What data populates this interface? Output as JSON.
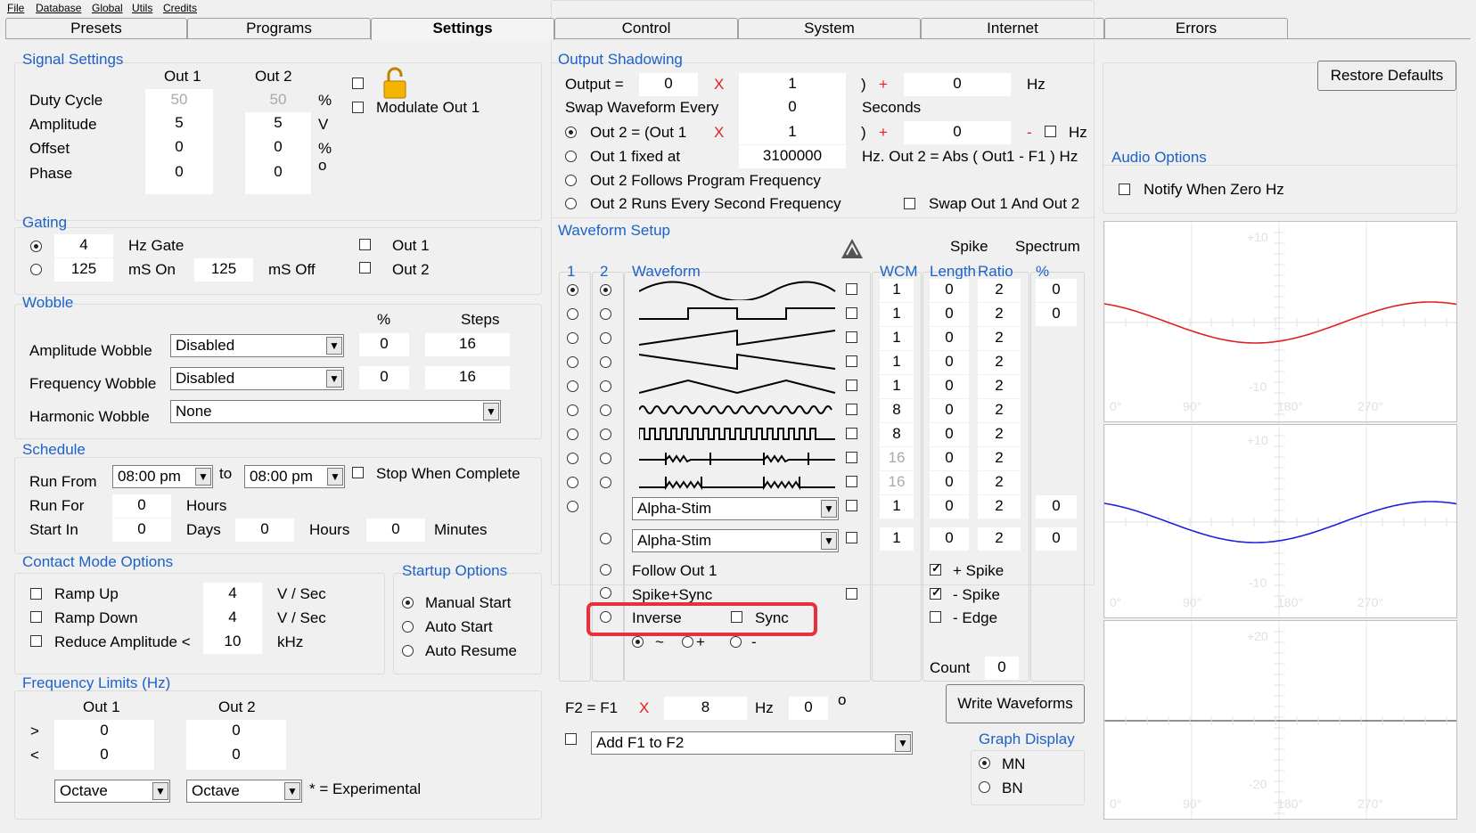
{
  "menu": [
    "File",
    "Database",
    "Global",
    "Utils",
    "Credits"
  ],
  "tabs": [
    "Presets",
    "Programs",
    "Settings",
    "Control",
    "System",
    "Internet",
    "Errors"
  ],
  "signal": {
    "title": "Signal Settings",
    "col1": "Out 1",
    "col2": "Out 2",
    "rows": [
      {
        "label": "Duty Cycle",
        "v1": "50",
        "v2": "50",
        "unit": "%"
      },
      {
        "label": "Amplitude",
        "v1": "5",
        "v2": "5",
        "unit": "V"
      },
      {
        "label": "Offset",
        "v1": "0",
        "v2": "0",
        "unit": "%"
      },
      {
        "label": "Phase",
        "v1": "0",
        "v2": "0",
        "unit": "o"
      }
    ],
    "modulate": "Modulate Out 1"
  },
  "gating": {
    "title": "Gating",
    "hz": "4",
    "hz_label": "Hz Gate",
    "ms_on": "125",
    "ms_on_label": "mS On",
    "ms_off": "125",
    "ms_off_label": "mS Off",
    "out1": "Out 1",
    "out2": "Out 2"
  },
  "wobble": {
    "title": "Wobble",
    "pct": "%",
    "steps": "Steps",
    "rows": [
      {
        "label": "Amplitude Wobble",
        "value": "Disabled",
        "pct": "0",
        "steps": "16"
      },
      {
        "label": "Frequency Wobble",
        "value": "Disabled",
        "pct": "0",
        "steps": "16"
      },
      {
        "label": "Harmonic Wobble",
        "value": "None"
      }
    ]
  },
  "schedule": {
    "title": "Schedule",
    "run_from": "Run From",
    "from": "08:00 pm",
    "to_label": "to",
    "to": "08:00 pm",
    "stop": "Stop When Complete",
    "run_for": "Run For",
    "run_for_v": "0",
    "hours": "Hours",
    "start_in": "Start In",
    "days_v": "0",
    "days": "Days",
    "hours_v": "0",
    "minutes_v": "0",
    "minutes": "Minutes"
  },
  "contact": {
    "title": "Contact Mode Options",
    "rows": [
      {
        "label": "Ramp Up",
        "v": "4",
        "unit": "V / Sec"
      },
      {
        "label": "Ramp Down",
        "v": "4",
        "unit": "V / Sec"
      },
      {
        "label": "Reduce Amplitude <",
        "v": "10",
        "unit": "kHz"
      }
    ]
  },
  "startup": {
    "title": "Startup Options",
    "opts": [
      "Manual Start",
      "Auto Start",
      "Auto Resume"
    ]
  },
  "freq": {
    "title": "Frequency Limits (Hz)",
    "out1": "Out 1",
    "out2": "Out 2",
    "gt": ">",
    "lt": "<",
    "gt1": "0",
    "gt2": "0",
    "lt1": "0",
    "lt2": "0",
    "sel1": "Octave",
    "sel2": "Octave",
    "note": "* = Experimental"
  },
  "shadow": {
    "title": "Output Shadowing",
    "output_label": "Output =",
    "o1": "0",
    "x": "X",
    "o2": "1",
    "paren": ")",
    "plus": "+",
    "o3": "0",
    "hz": "Hz",
    "swap_label": "Swap Waveform Every",
    "swap_v": "0",
    "seconds": "Seconds",
    "out2_label": "Out 2 = (Out 1",
    "out2_x": "1",
    "out2_add": "0",
    "minus": "-",
    "fixed_label": "Out 1 fixed at",
    "fixed_v": "3100000",
    "fixed_note": "Hz. Out 2 = Abs ( Out1 - F1 ) Hz",
    "follows": "Out 2 Follows Program Frequency",
    "runs": "Out 2 Runs Every Second Frequency",
    "swap12": "Swap Out 1 And Out 2"
  },
  "wave": {
    "title": "Waveform Setup",
    "h1": "1",
    "h2": "2",
    "hwave": "Waveform",
    "hwcm": "WCM",
    "hspike": "Spike",
    "hlen": "Length",
    "hratio": "Ratio",
    "hspec": "Spectrum",
    "hpct": "%",
    "rows": [
      {
        "wcm": "1",
        "len": "0",
        "ratio": "2",
        "spec": "0"
      },
      {
        "wcm": "1",
        "len": "0",
        "ratio": "2",
        "spec": "0"
      },
      {
        "wcm": "1",
        "len": "0",
        "ratio": "2"
      },
      {
        "wcm": "1",
        "len": "0",
        "ratio": "2"
      },
      {
        "wcm": "1",
        "len": "0",
        "ratio": "2"
      },
      {
        "wcm": "8",
        "len": "0",
        "ratio": "2"
      },
      {
        "wcm": "8",
        "len": "0",
        "ratio": "2"
      },
      {
        "wcm": "16",
        "len": "0",
        "ratio": "2"
      },
      {
        "wcm": "16",
        "len": "0",
        "ratio": "2"
      },
      {
        "wcm": "1",
        "len": "0",
        "ratio": "2",
        "spec": "0"
      },
      {
        "wcm": "1",
        "len": "0",
        "ratio": "2",
        "spec": "0"
      }
    ],
    "alpha1": "Alpha-Stim",
    "alpha2": "Alpha-Stim",
    "follow": "Follow Out 1",
    "spikesync": "Spike+Sync",
    "inverse": "Inverse",
    "sync": "Sync",
    "r_tilde": "~",
    "r_plus": "+",
    "r_minus": "-",
    "plus_spike": "+ Spike",
    "minus_spike": "- Spike",
    "minus_edge": "- Edge",
    "count_label": "Count",
    "count": "0",
    "f2_label": "F2 = F1",
    "f2_x": "X",
    "f2_v": "8",
    "f2_hz": "Hz",
    "f2_deg": "0",
    "f2_o": "o",
    "add": "Add F1 to F2",
    "write": "Write Waveforms"
  },
  "graph": {
    "title": "Graph Display",
    "mn": "MN",
    "bn": "BN"
  },
  "restore": "Restore Defaults",
  "audio": {
    "title": "Audio Options",
    "notify": "Notify When Zero Hz"
  },
  "charts": [
    {
      "top": "+10",
      "bot": "-10",
      "x": [
        "0°",
        "90°",
        "180°",
        "270°"
      ],
      "color": "#e02020"
    },
    {
      "top": "+10",
      "bot": "-10",
      "x": [
        "0°",
        "90°",
        "180°",
        "270°"
      ],
      "color": "#2020e0"
    },
    {
      "top": "+20",
      "bot": "-20",
      "x": [
        "0°",
        "90°",
        "180°",
        "270°"
      ],
      "color": "#222222"
    }
  ]
}
